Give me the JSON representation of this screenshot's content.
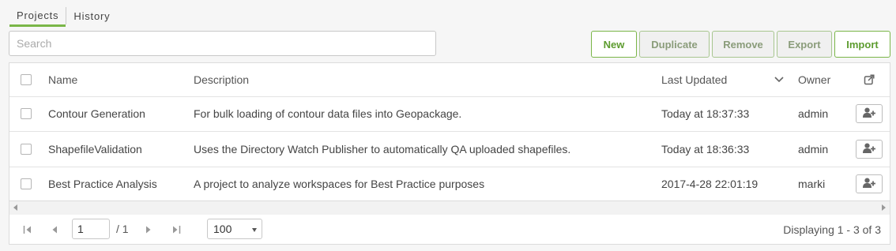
{
  "tabs": [
    {
      "label": "Projects",
      "active": true
    },
    {
      "label": "History",
      "active": false
    }
  ],
  "search": {
    "placeholder": "Search",
    "value": ""
  },
  "toolbar": {
    "new_label": "New",
    "duplicate_label": "Duplicate",
    "remove_label": "Remove",
    "export_label": "Export",
    "import_label": "Import"
  },
  "table": {
    "columns": {
      "name": "Name",
      "description": "Description",
      "last_updated": "Last Updated",
      "owner": "Owner"
    },
    "sort": {
      "column": "last_updated",
      "direction": "descending",
      "icon": "chevron-down-icon"
    },
    "header_action_icon": "share-export-icon",
    "rows": [
      {
        "name": "Contour Generation",
        "description": "For bulk loading of contour data files into Geopackage.",
        "last_updated": "Today at 18:37:33",
        "owner": "admin",
        "action_icon": "add-user-icon"
      },
      {
        "name": "ShapefileValidation",
        "description": "Uses the Directory Watch Publisher to automatically QA uploaded shapefiles.",
        "last_updated": "Today at 18:36:33",
        "owner": "admin",
        "action_icon": "add-user-icon"
      },
      {
        "name": "Best Practice Analysis",
        "description": "A project to analyze workspaces for Best Practice purposes",
        "last_updated": "2017-4-28 22:01:19",
        "owner": "marki",
        "action_icon": "add-user-icon"
      }
    ]
  },
  "pagination": {
    "current_page": "1",
    "total_pages": "/ 1",
    "page_size": "100",
    "displaying": "Displaying 1 - 3 of 3"
  },
  "colors": {
    "accent": "#7ab648",
    "accent_text": "#5d9c2f",
    "border": "#dcdcdc",
    "background": "#f6f6f6"
  }
}
